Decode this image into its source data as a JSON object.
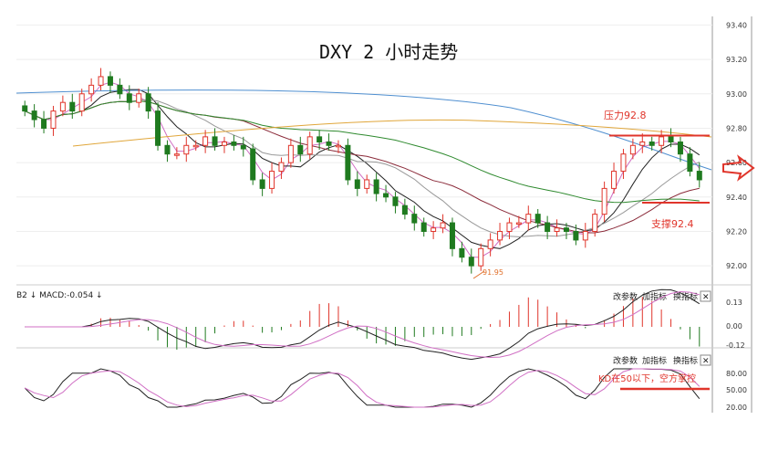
{
  "chart_data": {
    "type": "candlestick",
    "title": "DXY 2 小时走势",
    "ylim": [
      91.9,
      93.45
    ],
    "yticks": [
      "93.40",
      "93.20",
      "93.00",
      "92.80",
      "92.60",
      "92.40",
      "92.20",
      "92.00"
    ],
    "ytick_values": [
      93.4,
      93.2,
      93.0,
      92.8,
      92.6,
      92.4,
      92.2,
      92.0
    ],
    "low_label": "91.95",
    "annotations": {
      "resistance": {
        "label": "压力92.8",
        "value": 92.8
      },
      "support": {
        "label": "支撑92.4",
        "value": 92.4
      }
    },
    "closes": [
      92.9,
      92.85,
      92.8,
      92.9,
      92.95,
      92.9,
      93.0,
      93.05,
      93.1,
      93.05,
      93.0,
      92.95,
      93.0,
      92.9,
      92.7,
      92.65,
      92.65,
      92.7,
      92.7,
      92.75,
      92.7,
      92.72,
      92.7,
      92.68,
      92.5,
      92.45,
      92.55,
      92.6,
      92.7,
      92.65,
      92.75,
      92.72,
      92.7,
      92.7,
      92.5,
      92.45,
      92.5,
      92.42,
      92.4,
      92.35,
      92.3,
      92.25,
      92.2,
      92.22,
      92.25,
      92.1,
      92.05,
      92.0,
      92.1,
      92.15,
      92.2,
      92.25,
      92.25,
      92.3,
      92.25,
      92.2,
      92.22,
      92.2,
      92.15,
      92.2,
      92.3,
      92.45,
      92.55,
      92.65,
      92.7,
      92.72,
      92.7,
      92.75,
      92.72,
      92.65,
      92.55,
      92.5
    ]
  },
  "macd_panel": {
    "header_value": "B2 ↓ MACD:-0.054 ↓",
    "yticks": [
      "0.13",
      "0.00",
      "-0.12"
    ],
    "tools": [
      "改参数",
      "加指标",
      "换指标"
    ],
    "close_label": "✕"
  },
  "kd_panel": {
    "yticks": [
      "80.00",
      "50.00",
      "20.00"
    ],
    "tools": [
      "改参数",
      "加指标",
      "换指标"
    ],
    "annotation": "KD在50以下，空方掌控"
  },
  "colors": {
    "up": "#e0352b",
    "down": "#1f7a1f",
    "ma_blue": "#4f8fd0",
    "ma_orange": "#e0a63a",
    "ma_green": "#2f8a2f",
    "ma_maroon": "#8b2b3a",
    "ma_pink": "#d06fc4",
    "annotation_red": "#e0352b"
  }
}
